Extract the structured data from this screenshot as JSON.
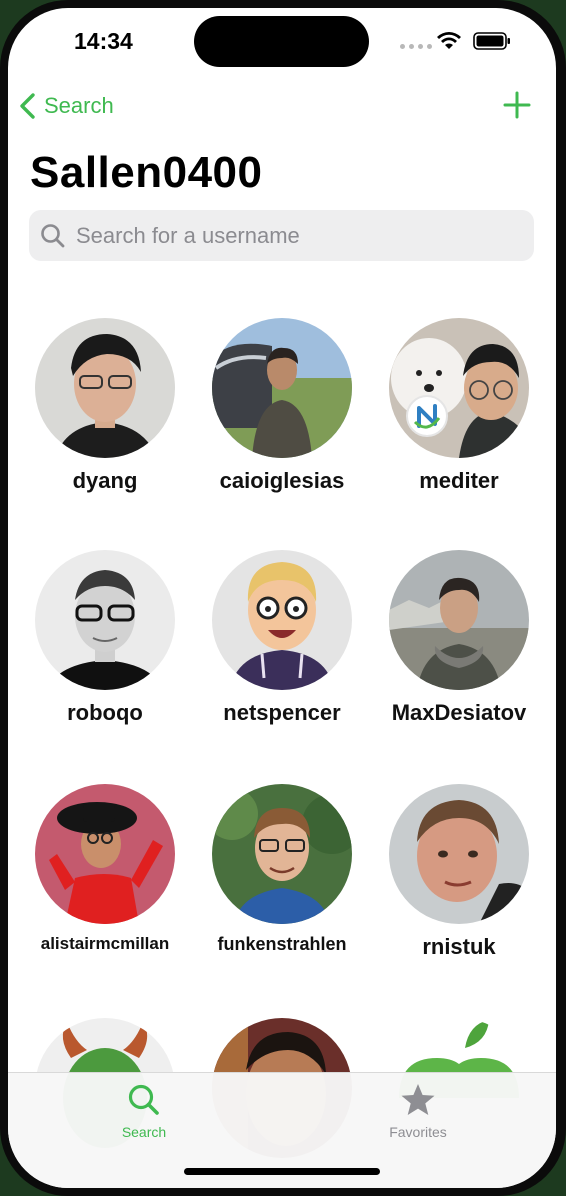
{
  "status_bar": {
    "time": "14:34"
  },
  "nav": {
    "back_label": "Search"
  },
  "page": {
    "title": "Sallen0400"
  },
  "search": {
    "placeholder": "Search for a username"
  },
  "users": [
    {
      "username": "dyang"
    },
    {
      "username": "caioiglesias"
    },
    {
      "username": "mediter"
    },
    {
      "username": "roboqo"
    },
    {
      "username": "netspencer"
    },
    {
      "username": "MaxDesiatov"
    },
    {
      "username": "alistairmcmillan"
    },
    {
      "username": "funkenstrahlen"
    },
    {
      "username": "rnistuk"
    },
    {
      "username": ""
    },
    {
      "username": ""
    },
    {
      "username": ""
    }
  ],
  "tab_bar": {
    "tabs": [
      {
        "label": "Search",
        "active": true
      },
      {
        "label": "Favorites",
        "active": false
      }
    ]
  },
  "colors": {
    "accent": "#3fb950",
    "inactive": "#8e8e93"
  }
}
